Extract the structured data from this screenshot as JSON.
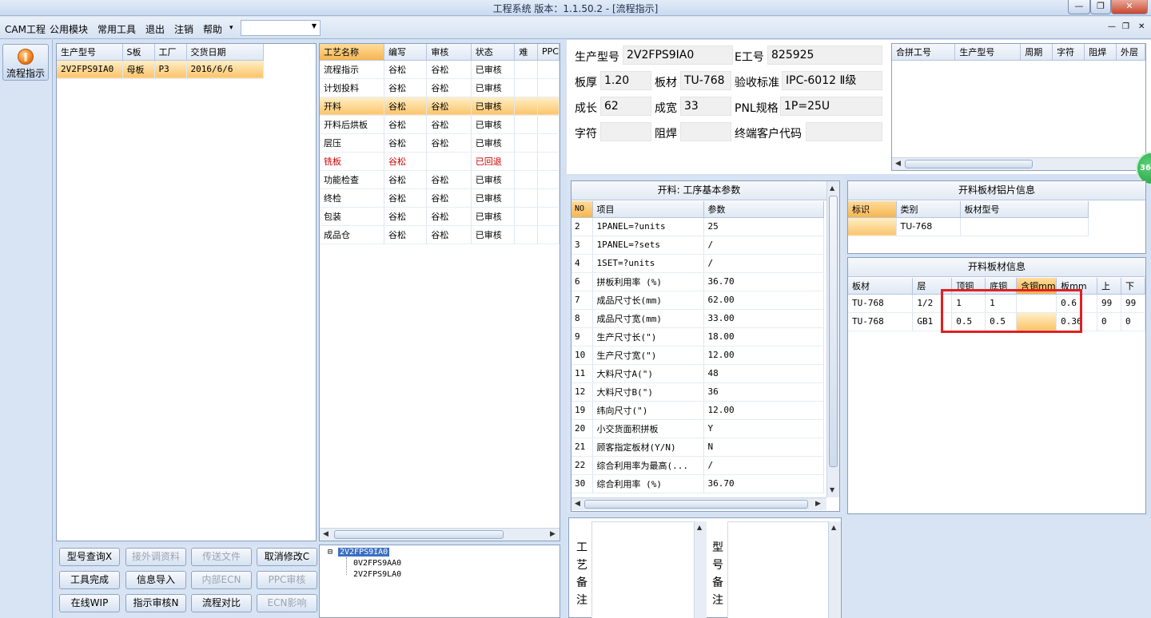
{
  "app": {
    "title": "工程系统    版本：1.1.50.2 - [流程指示]",
    "minimize_glyph": "—",
    "restore_glyph": "❐",
    "close_glyph": "✕"
  },
  "menu": {
    "items": [
      "CAM工程",
      "公用模块",
      "常用工具",
      "退出",
      "注销",
      "帮助"
    ],
    "help_arrow": "▾",
    "combo_value": "",
    "combo_arrow": "▼",
    "mdi_min": "—",
    "mdi_restore": "❐",
    "mdi_close": "✕"
  },
  "nav": {
    "button_label": "流程指示",
    "icon": "flow-icon"
  },
  "orders": {
    "headers": [
      "生产型号",
      "S板",
      "工厂",
      "交货日期"
    ],
    "rows": [
      [
        "2V2FPS9IA0",
        "母板",
        "P3",
        "2016/6/6"
      ]
    ]
  },
  "process": {
    "headers": [
      "工艺名称",
      "编写",
      "审核",
      "状态",
      "难",
      "PPC"
    ],
    "rows": [
      [
        "流程指示",
        "谷松",
        "谷松",
        "已审核",
        "",
        ""
      ],
      [
        "计划投料",
        "谷松",
        "谷松",
        "已审核",
        "",
        ""
      ],
      [
        "开料",
        "谷松",
        "谷松",
        "已审核",
        "",
        ""
      ],
      [
        "开料后烘板",
        "谷松",
        "谷松",
        "已审核",
        "",
        ""
      ],
      [
        "层压",
        "谷松",
        "谷松",
        "已审核",
        "",
        ""
      ],
      [
        "铣板",
        "谷松",
        "",
        "已回退",
        "",
        ""
      ],
      [
        "功能检查",
        "谷松",
        "谷松",
        "已审核",
        "",
        ""
      ],
      [
        "终检",
        "谷松",
        "谷松",
        "已审核",
        "",
        ""
      ],
      [
        "包装",
        "谷松",
        "谷松",
        "已审核",
        "",
        ""
      ],
      [
        "成品仓",
        "谷松",
        "谷松",
        "已审核",
        "",
        ""
      ]
    ]
  },
  "buttons": {
    "row1": [
      "型号查询X",
      "接外调资料",
      "传送文件",
      "取消修改C"
    ],
    "row2": [
      "工具完成",
      "信息导入",
      "内部ECN",
      "PPC审核"
    ],
    "row3": [
      "在线WIP",
      "指示审核N",
      "流程对比",
      "ECN影响"
    ]
  },
  "tree": {
    "root": "2V2FPS9IA0",
    "children": [
      "0V2FPS9AA0",
      "2V2FPS9LA0"
    ],
    "expander": "⊟"
  },
  "info": {
    "labels": [
      "生产型号",
      "E工号",
      "板厚",
      "板材",
      "验收标准",
      "成长",
      "成宽",
      "PNL规格",
      "字符",
      "阻焊",
      "终端客户代码"
    ],
    "values": {
      "model": "2V2FPS9IA0",
      "e_no": "825925",
      "thickness": "1.20",
      "material": "TU-768",
      "standard": "IPC-6012 Ⅱ级",
      "length": "62",
      "width": "33",
      "pnl": "1P=25U",
      "legend": "",
      "mask": "",
      "customer": ""
    }
  },
  "merge": {
    "headers": [
      "合拼工号",
      "生产型号",
      "周期",
      "字符",
      "阻焊",
      "外层"
    ]
  },
  "badge": {
    "text": "36"
  },
  "params": {
    "title": "开料: 工序基本参数",
    "headers": [
      "NO",
      "项目",
      "参数"
    ],
    "rows": [
      [
        "2",
        "1PANEL=?units",
        "25"
      ],
      [
        "3",
        "1PANEL=?sets",
        "/"
      ],
      [
        "4",
        "1SET=?units",
        "/"
      ],
      [
        "6",
        "拼板利用率 (%)",
        "36.70"
      ],
      [
        "7",
        "成品尺寸长(mm)",
        "62.00"
      ],
      [
        "8",
        "成品尺寸宽(mm)",
        "33.00"
      ],
      [
        "9",
        "生产尺寸长(\")",
        "18.00"
      ],
      [
        "10",
        "生产尺寸宽(\")",
        "12.00"
      ],
      [
        "11",
        "大料尺寸A(\")",
        "48"
      ],
      [
        "12",
        "大料尺寸B(\")",
        "36"
      ],
      [
        "19",
        "纬向尺寸(\")",
        "12.00"
      ],
      [
        "20",
        "小交货面积拼板",
        "Y"
      ],
      [
        "21",
        "顾客指定板材(Y/N)",
        "N"
      ],
      [
        "22",
        "综合利用率为最高(...",
        "/"
      ],
      [
        "30",
        "综合利用率 (%)",
        "36.70"
      ]
    ]
  },
  "foil": {
    "title": "开料板材铝片信息",
    "headers": [
      "标识",
      "类别",
      "板材型号"
    ],
    "rows": [
      [
        "",
        "TU-768",
        ""
      ]
    ]
  },
  "board": {
    "title": "开料板材信息",
    "headers": [
      "板材",
      "层",
      "顶铜",
      "底铜",
      "含铜mm",
      "板mm",
      "上",
      "下"
    ],
    "rows": [
      [
        "TU-768",
        "1/2",
        "1",
        "1",
        "",
        "0.6",
        "99",
        "99"
      ],
      [
        "TU-768",
        "GB1",
        "0.5",
        "0.5",
        "",
        "0.36",
        "0",
        "0"
      ]
    ],
    "highlight_color": "#e02020"
  },
  "remarks": {
    "process_label": "工艺备注",
    "model_label": "型号备注"
  }
}
